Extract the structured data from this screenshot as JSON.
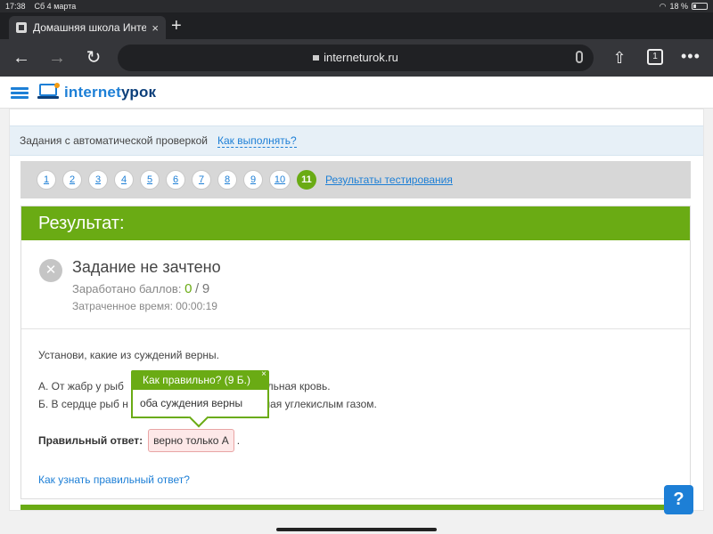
{
  "status": {
    "time": "17:38",
    "date": "Сб 4 марта",
    "battery": "18 %"
  },
  "browser": {
    "tab_title": "Домашняя школа Интер",
    "url": "interneturok.ru",
    "tabs_count": "1",
    "icons": [
      "back-icon",
      "forward-icon",
      "reload-icon",
      "lock-icon",
      "mic-icon",
      "share-icon",
      "tabs-icon",
      "menu-icon"
    ]
  },
  "site": {
    "logo_part1": "internet",
    "logo_part2": "урок"
  },
  "info": {
    "label": "Задания с автоматической проверкой",
    "link": "Как выполнять?"
  },
  "nav": {
    "questions": [
      "1",
      "2",
      "3",
      "4",
      "5",
      "6",
      "7",
      "8",
      "9",
      "10",
      "11"
    ],
    "results_link": "Результаты тестирования"
  },
  "result": {
    "header": "Результат:",
    "status_title": "Задание не зачтено",
    "score_label": "Заработано баллов:",
    "score_got": "0",
    "score_sep": "/",
    "score_max": "9",
    "time_label": "Затраченное время: 00:00:19"
  },
  "task": {
    "question": "Установи, какие из суждений верны.",
    "stmt_a_left": "А. От жабр у рыб",
    "stmt_a_right": "альная кровь.",
    "stmt_b_left": "Б. В сердце рыб н",
    "stmt_b_right": "нная углекислым газом.",
    "answer_label": "Правильный ответ:",
    "answer_value": "верно только А",
    "answer_dot": ".",
    "how_link": "Как узнать правильный ответ?"
  },
  "popup": {
    "title": "Как правильно? (9 Б.)",
    "close": "×",
    "body": "оба суждения верны"
  },
  "help": "?",
  "colors": {
    "green": "#6aab14",
    "blue": "#1d7fd6"
  }
}
